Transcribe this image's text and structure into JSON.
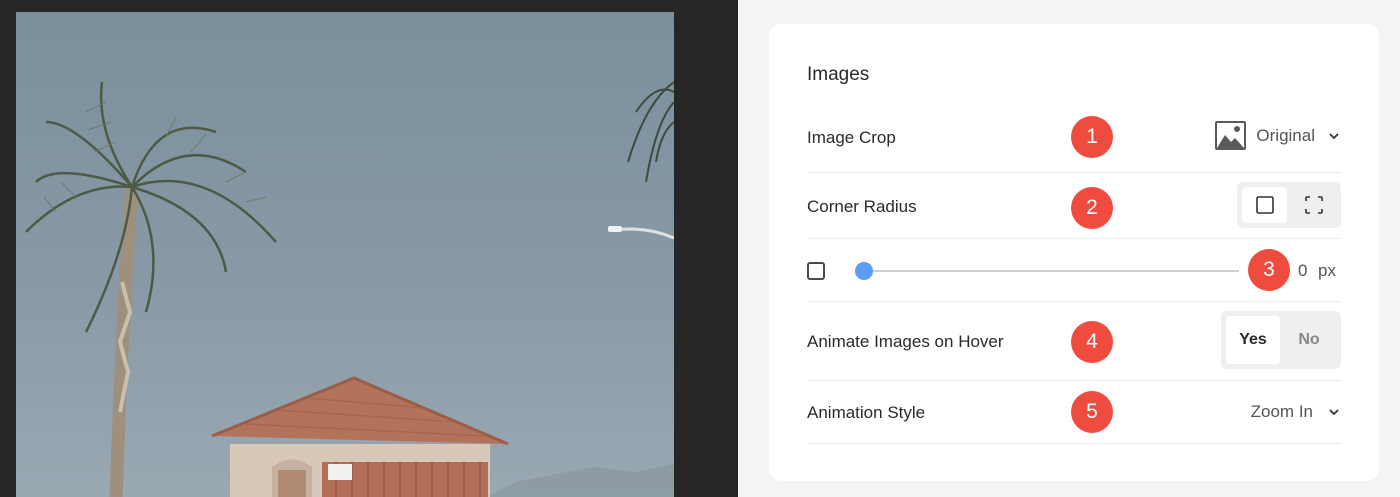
{
  "panel": {
    "title": "Images"
  },
  "rows": {
    "image_crop": {
      "label": "Image Crop",
      "badge": "1",
      "value": "Original",
      "icon": "image-icon"
    },
    "corner_radius": {
      "label": "Corner Radius",
      "badge": "2",
      "options": [
        "square-corners-icon",
        "rounded-corners-icon"
      ]
    },
    "radius_slider": {
      "badge": "3",
      "value": "0",
      "unit": "px",
      "level": 0
    },
    "animate_hover": {
      "label": "Animate Images on Hover",
      "badge": "4",
      "yes": "Yes",
      "no": "No",
      "selected": "Yes"
    },
    "animation_style": {
      "label": "Animation Style",
      "badge": "5",
      "value": "Zoom In"
    }
  },
  "colors": {
    "badge": "#f04b3f",
    "slider_thumb": "#5b9cf5",
    "preview_bg": "#262626"
  }
}
